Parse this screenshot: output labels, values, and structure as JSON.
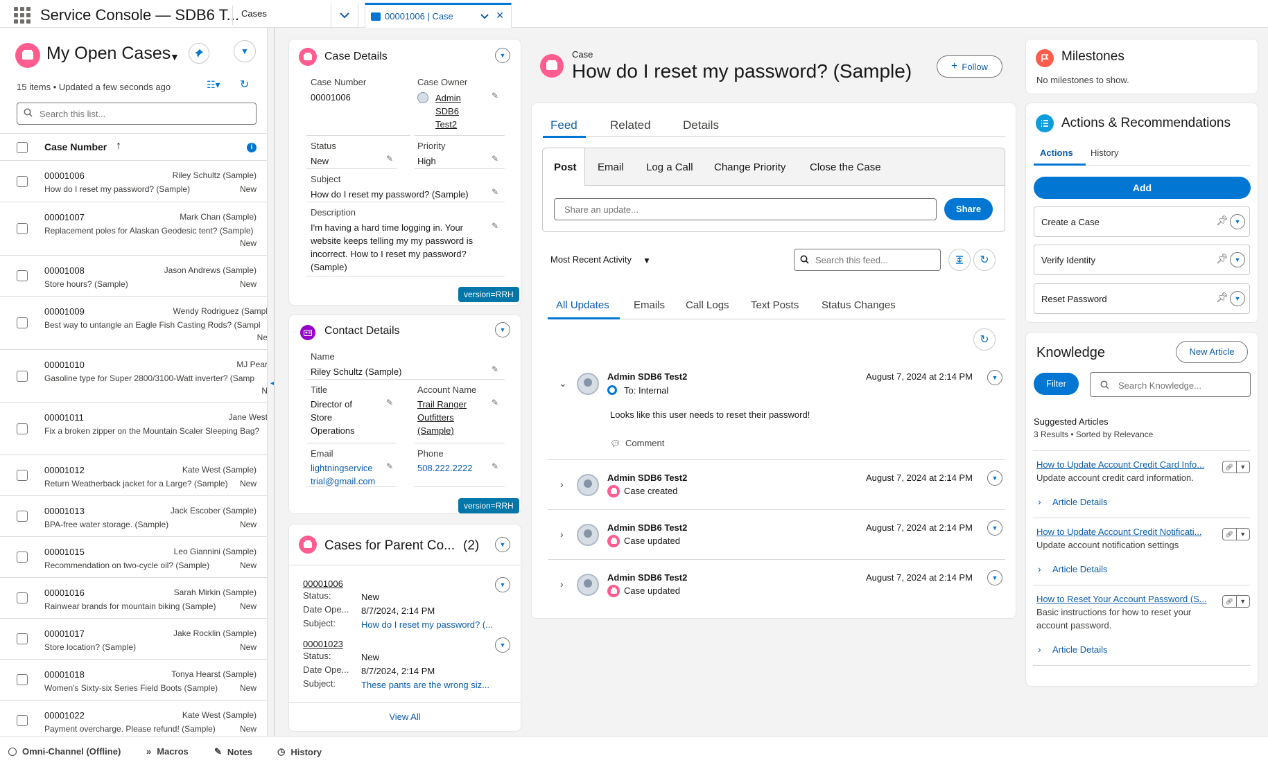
{
  "app": {
    "title": "Service Console — SDB6 T..."
  },
  "nav": {
    "selected": "Cases"
  },
  "workspace_tab": {
    "label": "00001006 | Case",
    "close": "✕"
  },
  "list": {
    "title": "My Open Cases",
    "meta": "15 items • Updated a few seconds ago",
    "search_placeholder": "Search this list...",
    "column_header": "Case Number",
    "sort_icon": "↑",
    "rows": [
      {
        "number": "00001006",
        "contact": "Riley Schultz (Sample)",
        "subject": "How do I reset my password? (Sample)",
        "status": "New"
      },
      {
        "number": "00001007",
        "contact": "Mark Chan (Sample)",
        "subject": "Replacement poles for Alaskan Geodesic tent? (Sample)",
        "status": "New"
      },
      {
        "number": "00001008",
        "contact": "Jason Andrews (Sample)",
        "subject": "Store hours? (Sample)",
        "status": "New"
      },
      {
        "number": "00001009",
        "contact": "Wendy Rodriguez (Sampl",
        "subject": "Best way to untangle an Eagle Fish Casting Rods? (Sampl",
        "status": "Ne"
      },
      {
        "number": "00001010",
        "contact": "MJ Pear",
        "subject": "Gasoline type for Super 2800/3100-Watt inverter? (Samp",
        "status": "N"
      },
      {
        "number": "00001011",
        "contact": "Jane West",
        "subject": "Fix a broken zipper on the Mountain Scaler Sleeping Bag?",
        "status": ""
      },
      {
        "number": "00001012",
        "contact": "Kate West (Sample)",
        "subject": "Return Weatherback jacket for a Large? (Sample)",
        "status": "New"
      },
      {
        "number": "00001013",
        "contact": "Jack Escober (Sample)",
        "subject": "BPA-free water storage. (Sample)",
        "status": "New"
      },
      {
        "number": "00001015",
        "contact": "Leo Giannini (Sample)",
        "subject": "Recommendation on two-cycle oil? (Sample)",
        "status": "New"
      },
      {
        "number": "00001016",
        "contact": "Sarah Mirkin (Sample)",
        "subject": "Rainwear brands for mountain biking (Sample)",
        "status": "New"
      },
      {
        "number": "00001017",
        "contact": "Jake Rocklin (Sample)",
        "subject": "Store location? (Sample)",
        "status": "New"
      },
      {
        "number": "00001018",
        "contact": "Tonya Hearst (Sample)",
        "subject": "Women's Sixty-six Series Field Boots (Sample)",
        "status": "New"
      },
      {
        "number": "00001022",
        "contact": "Kate West (Sample)",
        "subject": "Payment overcharge. Please refund! (Sample)",
        "status": "New"
      }
    ]
  },
  "case_details": {
    "title": "Case Details",
    "case_number_label": "Case Number",
    "case_number": "00001006",
    "owner_label": "Case Owner",
    "owner_lines": [
      "Admin",
      "SDB6",
      "Test2"
    ],
    "status_label": "Status",
    "status": "New",
    "priority_label": "Priority",
    "priority": "High",
    "subject_label": "Subject",
    "subject": "How do I reset my password? (Sample)",
    "description_label": "Description",
    "description_lines": [
      "I'm having a hard time logging in. Your",
      "website keeps telling my my password is",
      "incorrect. How to I reset my password?",
      "(Sample)"
    ],
    "version": "version=RRH"
  },
  "contact_details": {
    "title": "Contact Details",
    "name_label": "Name",
    "name": "Riley Schultz (Sample)",
    "title_label": "Title",
    "title_lines": [
      "Director of",
      "Store",
      "Operations"
    ],
    "account_label": "Account Name",
    "account_lines": [
      "Trail Ranger",
      "Outfitters",
      "(Sample)"
    ],
    "email_label": "Email",
    "email_lines": [
      "lightningservice",
      "trial@gmail.com"
    ],
    "phone_label": "Phone",
    "phone": "508.222.2222",
    "version": "version=RRH"
  },
  "parent_cases": {
    "title": "Cases for Parent Co...",
    "count": "(2)",
    "status_label": "Status:",
    "date_label": "Date Ope...",
    "subject_label": "Subject:",
    "items": [
      {
        "number": "00001006",
        "status": "New",
        "date": "8/7/2024, 2:14 PM",
        "subject": "How do I reset my password? (..."
      },
      {
        "number": "00001023",
        "status": "New",
        "date": "8/7/2024, 2:14 PM",
        "subject": "These pants are the wrong siz..."
      }
    ],
    "view_all": "View All"
  },
  "record": {
    "object_label": "Case",
    "title": "How do I reset my password? (Sample)",
    "follow_label": "Follow",
    "tabs": [
      "Feed",
      "Related",
      "Details"
    ],
    "publisher_tabs": [
      "Post",
      "Email",
      "Log a Call",
      "Change Priority",
      "Close the Case"
    ],
    "share_placeholder": "Share an update...",
    "share_label": "Share",
    "sort_label": "Most Recent Activity",
    "feed_search_placeholder": "Search this feed...",
    "feed_tabs": [
      "All Updates",
      "Emails",
      "Call Logs",
      "Text Posts",
      "Status Changes"
    ],
    "feed": [
      {
        "name": "Admin SDB6 Test2",
        "date": "August 7, 2024 at 2:14 PM",
        "desc": "To: Internal",
        "body": "Looks like this user needs to reset their password!",
        "comment": "Comment"
      },
      {
        "name": "Admin SDB6 Test2",
        "date": "August 7, 2024 at 2:14 PM",
        "desc": "Case created"
      },
      {
        "name": "Admin SDB6 Test2",
        "date": "August 7, 2024 at 2:14 PM",
        "desc": "Case updated"
      },
      {
        "name": "Admin SDB6 Test2",
        "date": "August 7, 2024 at 2:14 PM",
        "desc": "Case updated"
      }
    ]
  },
  "milestones": {
    "title": "Milestones",
    "empty": "No milestones to show."
  },
  "actions": {
    "title": "Actions & Recommendations",
    "tabs": [
      "Actions",
      "History"
    ],
    "add_label": "Add",
    "items": [
      "Create a Case",
      "Verify Identity",
      "Reset Password"
    ]
  },
  "knowledge": {
    "title": "Knowledge",
    "new_article": "New Article",
    "filter": "Filter",
    "search_placeholder": "Search Knowledge...",
    "suggested_title": "Suggested Articles",
    "results_meta": "3 Results • Sorted by Relevance",
    "details_label": "Article Details",
    "articles": [
      {
        "title": "How to Update Account Credit Card Info...",
        "desc_lines": [
          "Update account credit card information."
        ]
      },
      {
        "title": "How to Update Account Credit Notificati...",
        "desc_lines": [
          "Update account notification settings"
        ]
      },
      {
        "title": "How to Reset Your Account Password (S...",
        "desc_lines": [
          "Basic instructions for how to reset your",
          "account password."
        ]
      }
    ]
  },
  "utility": {
    "items": [
      "Omni-Channel (Offline)",
      "Macros",
      "Notes",
      "History"
    ]
  },
  "colors": {
    "brand": "#0176d3",
    "case_pink": "#ff5d8f",
    "link": "#0b5cab"
  }
}
